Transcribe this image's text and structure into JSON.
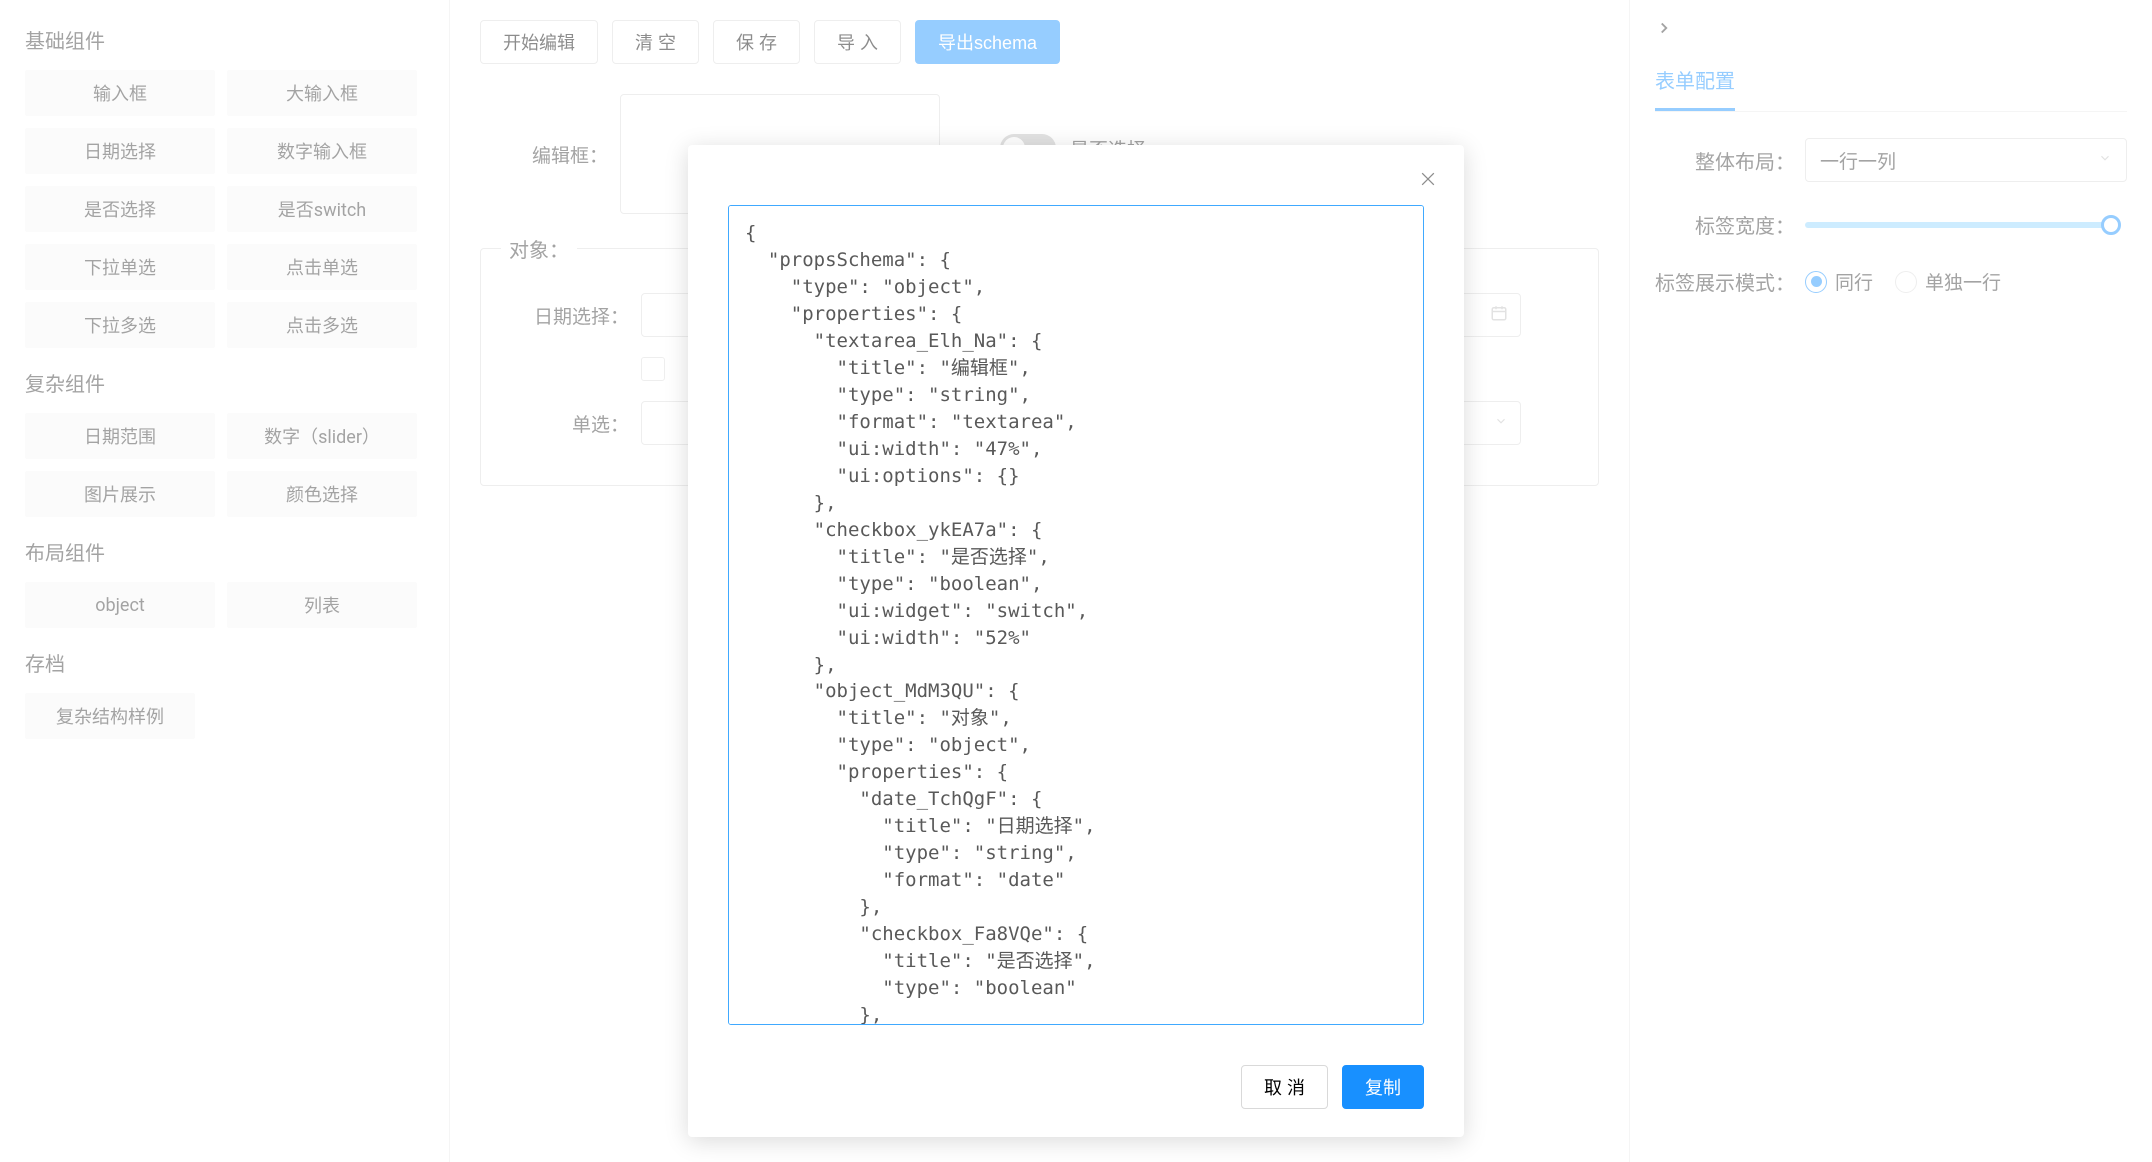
{
  "sidebar": {
    "section_basic": "基础组件",
    "basic_items": [
      "输入框",
      "大输入框",
      "日期选择",
      "数字输入框",
      "是否选择",
      "是否switch",
      "下拉单选",
      "点击单选",
      "下拉多选",
      "点击多选"
    ],
    "section_complex": "复杂组件",
    "complex_items": [
      "日期范围",
      "数字（slider）",
      "图片展示",
      "颜色选择"
    ],
    "section_layout": "布局组件",
    "layout_items": [
      "object",
      "列表"
    ],
    "section_archive": "存档",
    "archive_items": [
      "复杂结构样例"
    ]
  },
  "toolbar": {
    "start_edit": "开始编辑",
    "clear": "清 空",
    "save": "保 存",
    "import": "导 入",
    "export_schema": "导出schema"
  },
  "form": {
    "edit_box_label": "编辑框：",
    "switch_label": "是否选择",
    "object_legend": "对象：",
    "date_label": "日期选择：",
    "radio_label": "单选："
  },
  "right": {
    "tab_form_config": "表单配置",
    "layout_label": "整体布局：",
    "layout_value": "一行一列",
    "label_width_label": "标签宽度：",
    "label_mode_label": "标签展示模式：",
    "radio_inline": "同行",
    "radio_newline": "单独一行"
  },
  "modal": {
    "cancel": "取 消",
    "copy": "复制",
    "code": "{\n  \"propsSchema\": {\n    \"type\": \"object\",\n    \"properties\": {\n      \"textarea_Elh_Na\": {\n        \"title\": \"编辑框\",\n        \"type\": \"string\",\n        \"format\": \"textarea\",\n        \"ui:width\": \"47%\",\n        \"ui:options\": {}\n      },\n      \"checkbox_ykEA7a\": {\n        \"title\": \"是否选择\",\n        \"type\": \"boolean\",\n        \"ui:widget\": \"switch\",\n        \"ui:width\": \"52%\"\n      },\n      \"object_MdM3QU\": {\n        \"title\": \"对象\",\n        \"type\": \"object\",\n        \"properties\": {\n          \"date_TchQgF\": {\n            \"title\": \"日期选择\",\n            \"type\": \"string\",\n            \"format\": \"date\"\n          },\n          \"checkbox_Fa8VQe\": {\n            \"title\": \"是否选择\",\n            \"type\": \"boolean\"\n          },"
  }
}
